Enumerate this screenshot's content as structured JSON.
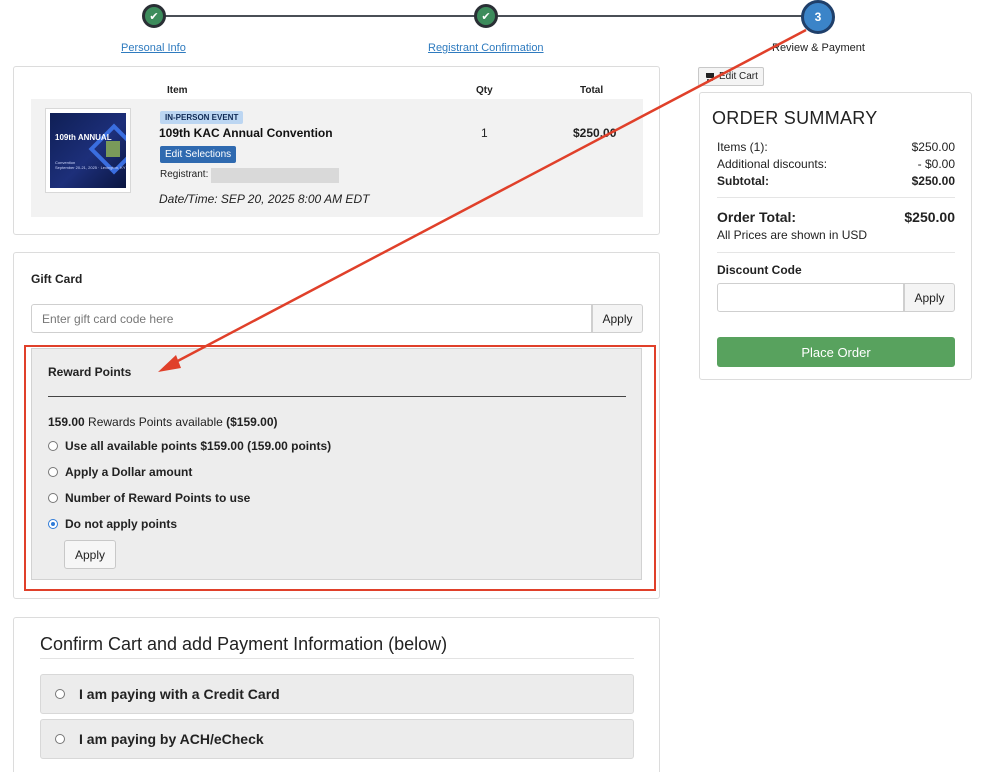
{
  "stepper": {
    "steps": [
      {
        "label": "Personal Info",
        "state": "done",
        "icon": "check-icon"
      },
      {
        "label": "Registrant Confirmation",
        "state": "done",
        "icon": "check-icon"
      },
      {
        "label": "Review & Payment",
        "state": "current",
        "number": "3"
      }
    ]
  },
  "cart": {
    "columns": {
      "item": "Item",
      "qty": "Qty",
      "total": "Total"
    },
    "row": {
      "thumbnail": {
        "big_text": "109th ANNUAL",
        "sub_text": "Convention",
        "small_text": "September 20-21, 2025 · Lexington, KY"
      },
      "badge": "IN-PERSON EVENT",
      "title": "109th KAC Annual Convention",
      "edit_label": "Edit Selections",
      "registrant_label": "Registrant:",
      "datetime": "Date/Time: SEP 20, 2025 8:00 AM EDT",
      "qty": "1",
      "total": "$250.00"
    }
  },
  "gift_card": {
    "title": "Gift Card",
    "placeholder": "Enter gift card code here",
    "apply_label": "Apply"
  },
  "reward_points": {
    "title": "Reward Points",
    "available_points": "159.00",
    "available_text": "Rewards Points available",
    "available_amount": "($159.00)",
    "options": [
      {
        "label": "Use all available points $159.00 (159.00 points)",
        "selected": false
      },
      {
        "label": "Apply a Dollar amount",
        "selected": false
      },
      {
        "label": "Number of Reward Points to use",
        "selected": false
      },
      {
        "label": "Do not apply points",
        "selected": true
      }
    ],
    "apply_label": "Apply"
  },
  "payment": {
    "title": "Confirm Cart and add Payment Information (below)",
    "options": [
      {
        "label": "I am paying with a Credit Card"
      },
      {
        "label": "I am paying by ACH/eCheck"
      }
    ]
  },
  "order_summary": {
    "edit_cart_label": "Edit Cart",
    "title": "ORDER SUMMARY",
    "items_label": "Items (1):",
    "items_value": "$250.00",
    "discounts_label": "Additional discounts:",
    "discounts_value": "- $0.00",
    "subtotal_label": "Subtotal:",
    "subtotal_value": "$250.00",
    "total_label": "Order Total:",
    "total_value": "$250.00",
    "currency_note": "All Prices are shown in USD",
    "discount_code_label": "Discount Code",
    "discount_apply_label": "Apply",
    "place_order_label": "Place Order"
  },
  "colors": {
    "accent_blue": "#3b84c8",
    "step_done_green": "#3d8c5c",
    "place_order_green": "#58a25e",
    "annotation_red": "#e0402a",
    "link_blue": "#2f7bbf"
  }
}
